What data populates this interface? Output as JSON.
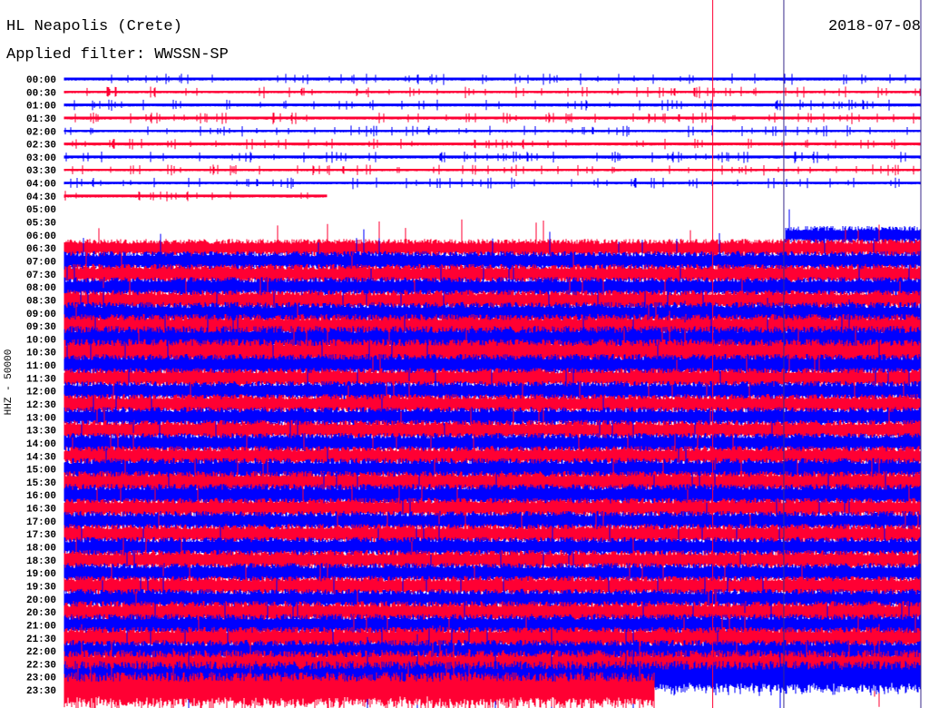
{
  "header": {
    "station": "HL Neapolis (Crete)",
    "filter": "Applied filter: WWSSN-SP",
    "date": "2018-07-08"
  },
  "chart_data": {
    "type": "line",
    "title": "HL Neapolis (Crete)",
    "subtitle": "Applied filter: WWSSN-SP",
    "date": "2018-07-08",
    "ylabel": "HHZ - 50000",
    "xlabel": "",
    "colors": {
      "even": "#0000ff",
      "odd": "#ff0033",
      "marker_red": "#ff0033",
      "marker_dark": "#3a2a8a"
    },
    "rows": [
      {
        "time": "00:00",
        "amp": 1.5,
        "end": 1
      },
      {
        "time": "00:30",
        "amp": 1.2,
        "end": 1
      },
      {
        "time": "01:00",
        "amp": 1.5,
        "end": 1
      },
      {
        "time": "01:30",
        "amp": 1.5,
        "end": 1
      },
      {
        "time": "02:00",
        "amp": 1.2,
        "end": 1
      },
      {
        "time": "02:30",
        "amp": 1.5,
        "end": 1
      },
      {
        "time": "03:00",
        "amp": 1.5,
        "end": 1
      },
      {
        "time": "03:30",
        "amp": 1.2,
        "end": 1
      },
      {
        "time": "04:00",
        "amp": 1.3,
        "end": 1
      },
      {
        "time": "04:30",
        "amp": 1.5,
        "end": 0.307
      },
      {
        "time": "05:00",
        "amp": 0,
        "end": 0
      },
      {
        "time": "05:30",
        "amp": 0,
        "end": 0
      },
      {
        "time": "06:00",
        "amp": 9,
        "end": 1,
        "start": 0.842
      },
      {
        "time": "06:30",
        "amp": 9,
        "end": 1
      },
      {
        "time": "07:00",
        "amp": 10,
        "end": 1
      },
      {
        "time": "07:30",
        "amp": 10,
        "end": 1
      },
      {
        "time": "08:00",
        "amp": 10,
        "end": 1
      },
      {
        "time": "08:30",
        "amp": 10,
        "end": 1
      },
      {
        "time": "09:00",
        "amp": 11,
        "end": 1
      },
      {
        "time": "09:30",
        "amp": 12,
        "end": 1
      },
      {
        "time": "10:00",
        "amp": 13,
        "end": 1
      },
      {
        "time": "10:30",
        "amp": 13,
        "end": 1
      },
      {
        "time": "11:00",
        "amp": 11,
        "end": 1
      },
      {
        "time": "11:30",
        "amp": 10,
        "end": 1
      },
      {
        "time": "12:00",
        "amp": 10,
        "end": 1
      },
      {
        "time": "12:30",
        "amp": 10,
        "end": 1
      },
      {
        "time": "13:00",
        "amp": 10,
        "end": 1
      },
      {
        "time": "13:30",
        "amp": 10,
        "end": 1
      },
      {
        "time": "14:00",
        "amp": 10,
        "end": 1
      },
      {
        "time": "14:30",
        "amp": 10,
        "end": 1
      },
      {
        "time": "15:00",
        "amp": 11,
        "end": 1
      },
      {
        "time": "15:30",
        "amp": 11,
        "end": 1
      },
      {
        "time": "16:00",
        "amp": 11,
        "end": 1
      },
      {
        "time": "16:30",
        "amp": 10,
        "end": 1
      },
      {
        "time": "17:00",
        "amp": 10,
        "end": 1
      },
      {
        "time": "17:30",
        "amp": 10,
        "end": 1
      },
      {
        "time": "18:00",
        "amp": 10,
        "end": 1
      },
      {
        "time": "18:30",
        "amp": 10,
        "end": 1
      },
      {
        "time": "19:00",
        "amp": 10,
        "end": 1
      },
      {
        "time": "19:30",
        "amp": 10,
        "end": 1
      },
      {
        "time": "20:00",
        "amp": 10,
        "end": 1
      },
      {
        "time": "20:30",
        "amp": 11,
        "end": 1
      },
      {
        "time": "21:00",
        "amp": 11,
        "end": 1
      },
      {
        "time": "21:30",
        "amp": 11,
        "end": 1
      },
      {
        "time": "22:00",
        "amp": 11,
        "end": 1
      },
      {
        "time": "22:30",
        "amp": 14,
        "end": 1
      },
      {
        "time": "23:00",
        "amp": 16,
        "end": 1
      },
      {
        "time": "23:30",
        "amp": 18,
        "end": 0.689
      }
    ],
    "event_markers_fraction": [
      0.757,
      0.84,
      1.0
    ]
  }
}
